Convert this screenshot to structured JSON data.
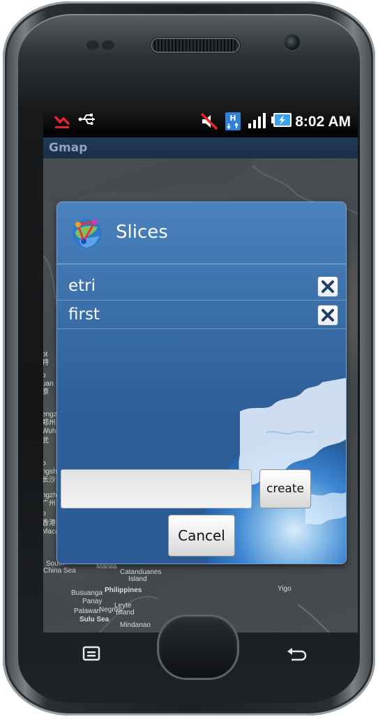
{
  "status_bar": {
    "time": "8:02 AM",
    "icons_left": [
      "missed-event-icon",
      "usb-icon"
    ],
    "icons_right": [
      "mute-icon",
      "hsdpa-icon",
      "signal-icon",
      "battery-charging-icon"
    ]
  },
  "app": {
    "title": "Gmap"
  },
  "map": {
    "labels": {
      "l1": "ot",
      "l2": "特",
      "l3": "o",
      "l4": "uan",
      "l5": "原",
      "l6": "engz",
      "l7": "郑州",
      "l8": "Wuh",
      "l9": "武",
      "l10": "o",
      "l11": "ngsh",
      "l12": "长沙",
      "l13": "ngzh",
      "l14": "广州",
      "l15": "o",
      "l16": "香港",
      "l17": "Maca",
      "south": "South",
      "china_sea": "China Sea",
      "manila": "Manila",
      "catanduanes": "Catanduanes",
      "island": "Island",
      "busuanga": "Busuanga",
      "philippines": "Philippines",
      "panay": "Panay",
      "leyte": "Leyte",
      "palawan": "Palawan",
      "negros": "Negros",
      "island2": "Island",
      "sulu_sea": "Sulu Sea",
      "mindanao": "Mindanao",
      "yigo": "Yigo"
    }
  },
  "dialog": {
    "title": "Slices",
    "slices": [
      {
        "name": "etri"
      },
      {
        "name": "first"
      }
    ],
    "input": {
      "value": "",
      "placeholder": ""
    },
    "create_label": "create",
    "cancel_label": "Cancel"
  },
  "colors": {
    "dialog_top": "#4a82be",
    "dialog_bottom": "#2a5a93",
    "title_bar": "#1a2e48",
    "title_text": "#8ea6c2"
  }
}
